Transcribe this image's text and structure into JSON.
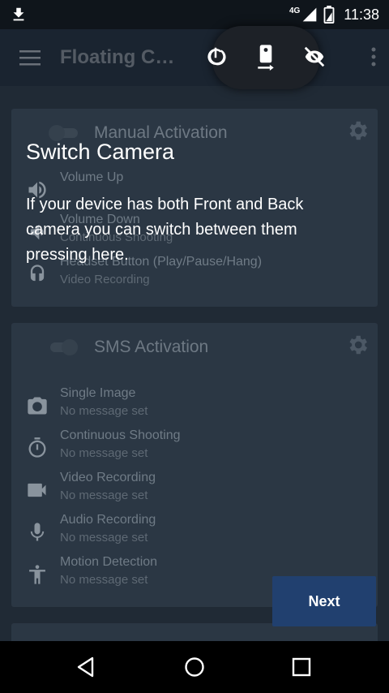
{
  "status_bar": {
    "network": "4G",
    "time": "11:38"
  },
  "app_bar": {
    "title": "Floating C…"
  },
  "cards": [
    {
      "title": "Manual Activation",
      "rows": [
        {
          "icon": "volume-up-icon",
          "title": "Volume Up",
          "subtitle": ""
        },
        {
          "icon": "volume-down-icon",
          "title": "Volume Down",
          "subtitle": "Continuous Shooting"
        },
        {
          "icon": "headset-icon",
          "title": "Headset Button (Play/Pause/Hang)",
          "subtitle": "Video Recording"
        }
      ]
    },
    {
      "title": "SMS Activation",
      "rows": [
        {
          "icon": "camera-icon",
          "title": "Single Image",
          "subtitle": "No message set"
        },
        {
          "icon": "timer-icon",
          "title": "Continuous Shooting",
          "subtitle": "No message set"
        },
        {
          "icon": "videocam-icon",
          "title": "Video Recording",
          "subtitle": "No message set"
        },
        {
          "icon": "mic-icon",
          "title": "Audio Recording",
          "subtitle": "No message set"
        },
        {
          "icon": "person-icon",
          "title": "Motion Detection",
          "subtitle": "No message set"
        }
      ]
    }
  ],
  "tutorial": {
    "title": "Switch Camera",
    "body": "If your device has both Front and Back camera you can switch between them pressing here."
  },
  "next_button": {
    "label": "Next"
  },
  "colors": {
    "accent": "#21406f",
    "overlay": "#1c2530"
  }
}
